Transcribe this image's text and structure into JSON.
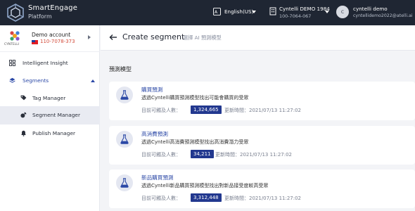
{
  "topbar": {
    "brand_line1": "SmartEngage",
    "brand_line2": "Platform",
    "language": "English(US)",
    "account_name": "Cyntelli DEMO 1984",
    "account_phone": "100-7064-067",
    "avatar_initial": "c",
    "user_name": "cyntelli demo",
    "user_email": "cyntellidemo2022@atelli.ai"
  },
  "sidebar": {
    "account_logo_text": "CYNTELLI",
    "account_name": "Demo account",
    "account_phone": "110-7078-373",
    "items": [
      {
        "label": "Intelligent Insight",
        "icon": "grid-icon"
      },
      {
        "label": "Segments",
        "icon": "layers-icon"
      },
      {
        "label": "Tag Manager",
        "icon": "tag-icon"
      },
      {
        "label": "Segment Manager",
        "icon": "segment-icon"
      },
      {
        "label": "Publish Manager",
        "icon": "bell-icon"
      }
    ]
  },
  "main": {
    "title": "Create segment",
    "subtitle": "選擇 AI 預測模型",
    "section_title": "預測模型",
    "count_label": "目前可觸及人數：",
    "cards": [
      {
        "title": "購買預測",
        "description": "透過Cyntelli購買預測模型找出可能會購買的受眾",
        "count": "1,324,665",
        "updated": "更新時間：2021/07/13 11:27:02"
      },
      {
        "title": "高消費預測",
        "description": "透過Cyntelli高消費預測模型找出高消費潛力受眾",
        "count": "34,211",
        "updated": "更新時間：2021/07/13 11:27:02"
      },
      {
        "title": "新品購買預測",
        "description": "透過Cyntelli新品購買預測模型找出對新品接受度較高受眾",
        "count": "3,312,448",
        "updated": "更新時間：2021/07/13 11:27:02"
      }
    ]
  },
  "colors": {
    "topbar_bg": "#1f2633",
    "accent": "#2b48a6",
    "badge_bg": "#22388f",
    "active_row": "#e9ebf2"
  }
}
